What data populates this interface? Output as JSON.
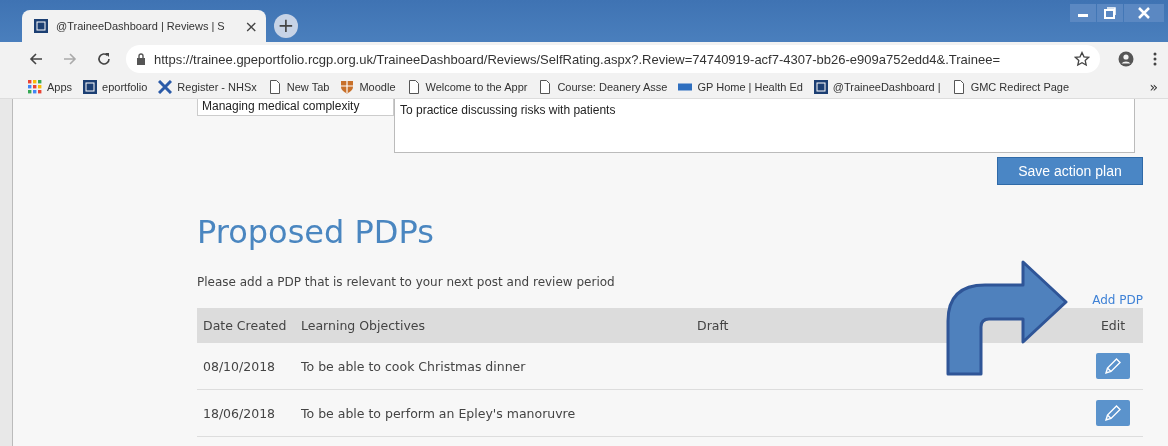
{
  "browser": {
    "tab": {
      "title": "@TraineeDashboard | Reviews | S",
      "close": "×"
    },
    "new_tab": "+",
    "address": "https://trainee.gpeportfolio.rcgp.org.uk/TraineeDashboard/Reviews/SelfRating.aspx?.Review=74740919-acf7-4307-bb26-e909a752edd4&.Trainee=",
    "bookmarks": [
      {
        "label": "Apps",
        "kind": "apps"
      },
      {
        "label": "eportfolio",
        "kind": "logo"
      },
      {
        "label": "Register - NHSx",
        "kind": "cross"
      },
      {
        "label": "New Tab",
        "kind": "page"
      },
      {
        "label": "Moodle",
        "kind": "shield"
      },
      {
        "label": "Welcome to the Appr",
        "kind": "page"
      },
      {
        "label": "Course: Deanery Asse",
        "kind": "page"
      },
      {
        "label": "GP Home | Health Ed",
        "kind": "nhs"
      },
      {
        "label": "@TraineeDashboard |",
        "kind": "logo"
      },
      {
        "label": "GMC Redirect Page",
        "kind": "page"
      }
    ],
    "more": "»"
  },
  "action_plan": {
    "competency": "Managing medical complexity",
    "plan_text": "To practice discussing risks with patients",
    "save_button": "Save action plan"
  },
  "pdps": {
    "title": "Proposed PDPs",
    "intro": "Please add a PDP that is relevant to your next post and review period",
    "add_link": "Add PDP",
    "columns": [
      "Date Created",
      "Learning Objectives",
      "Draft",
      "Edit"
    ],
    "rows": [
      {
        "date": "08/10/2018",
        "objective": "To be able to cook Christmas dinner"
      },
      {
        "date": "18/06/2018",
        "objective": "To be able to perform an Epley's manoruvre"
      }
    ]
  }
}
